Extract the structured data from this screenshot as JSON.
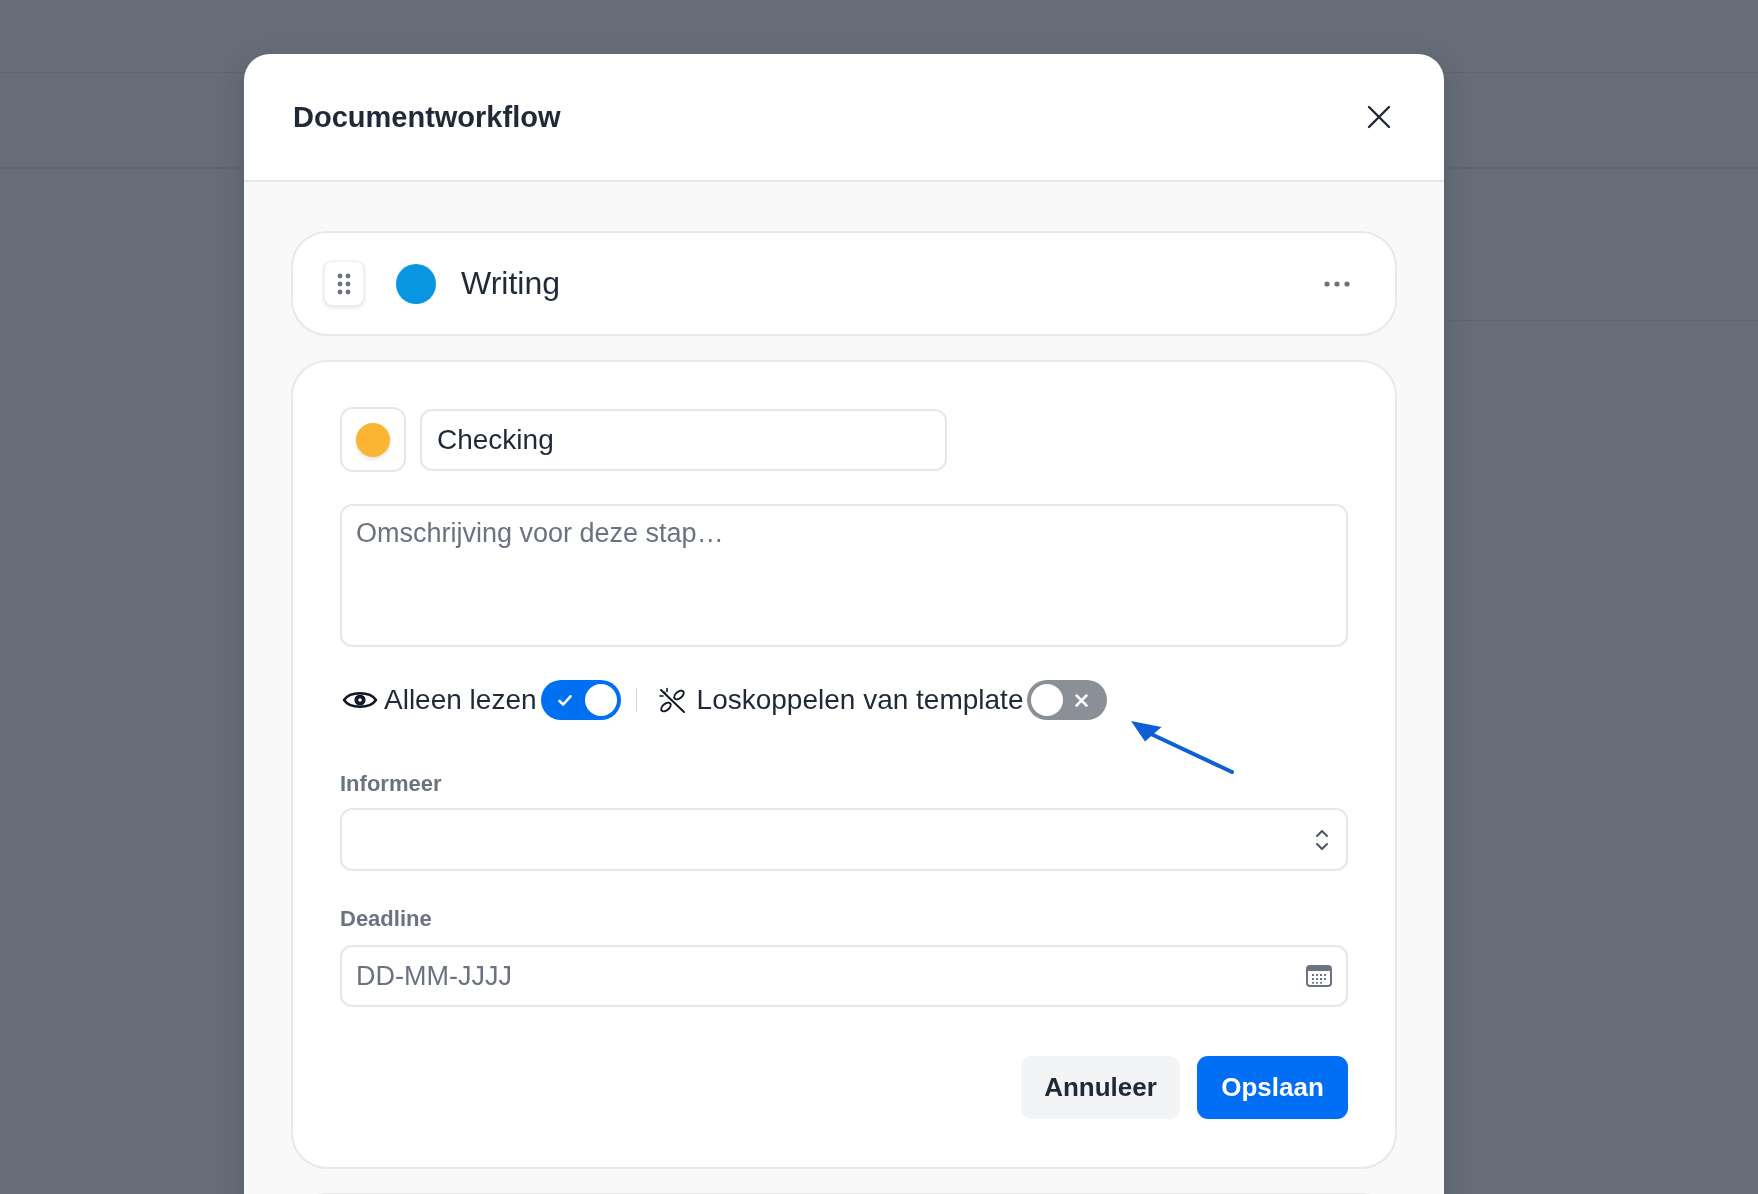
{
  "dialog": {
    "title": "Documentworkflow"
  },
  "steps": [
    {
      "name": "Writing",
      "color": "#0996e1",
      "expanded": false
    },
    {
      "name": "Checking",
      "color": "#fbb532",
      "expanded": true,
      "description_placeholder": "Omschrijving voor deze stap…",
      "options": [
        {
          "label": "Alleen lezen",
          "on": true
        },
        {
          "label": "Loskoppelen van template",
          "on": false
        }
      ],
      "fields": [
        {
          "kind": "select",
          "label": "Informeer"
        },
        {
          "kind": "date",
          "label": "Deadline",
          "placeholder": "DD-MM-JJJJ"
        }
      ],
      "buttons": [
        {
          "kind": "secondary",
          "label": "Annuleer"
        },
        {
          "kind": "primary",
          "label": "Opslaan"
        }
      ]
    }
  ]
}
